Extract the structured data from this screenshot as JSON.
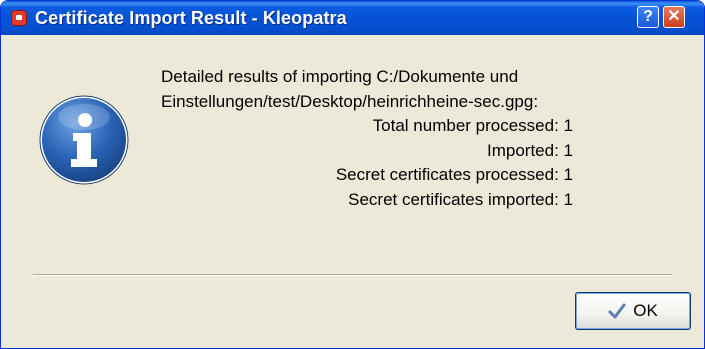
{
  "window": {
    "title": "Certificate Import Result - Kleopatra"
  },
  "titlebar": {
    "help_label": "?",
    "close_label": "✕"
  },
  "message": {
    "line1": "Detailed results of importing C:/Dokumente und",
    "line2": "Einstellungen/test/Desktop/heinrichheine-sec.gpg:"
  },
  "stats": [
    {
      "text": "Total number processed: 1"
    },
    {
      "text": "Imported: 1"
    },
    {
      "text": "Secret certificates processed: 1"
    },
    {
      "text": "Secret certificates imported: 1"
    }
  ],
  "buttons": {
    "ok_label": "OK"
  },
  "colors": {
    "titlebar": "#0653d6",
    "dialog_bg": "#ece9d8",
    "info_icon": "#1f5aa8"
  },
  "icons": {
    "app": "kleopatra-icon",
    "info": "info-icon",
    "ok": "checkmark-icon"
  }
}
